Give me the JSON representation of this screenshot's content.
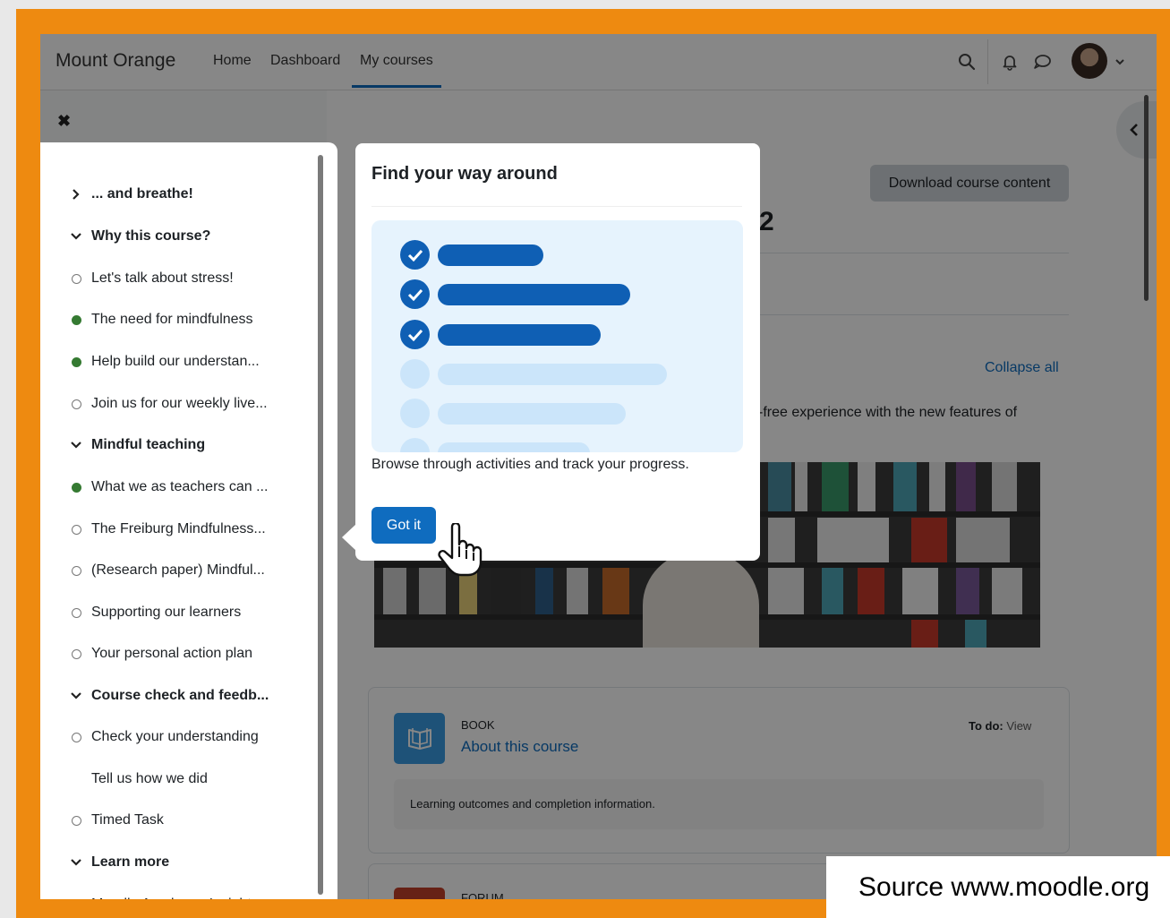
{
  "navbar": {
    "brand": "Mount Orange",
    "links": [
      "Home",
      "Dashboard",
      "My courses"
    ],
    "active_link": "My courses"
  },
  "drawer": {
    "close_symbol": "✖",
    "items": [
      {
        "type": "section",
        "label": "... and breathe!",
        "state": "collapsed"
      },
      {
        "type": "section",
        "label": "Why this course?",
        "state": "expanded"
      },
      {
        "type": "activity",
        "label": "Let's talk about stress!",
        "completion": "incomplete"
      },
      {
        "type": "activity",
        "label": "The need for mindfulness",
        "completion": "complete"
      },
      {
        "type": "activity",
        "label": "Help build our understan...",
        "completion": "complete"
      },
      {
        "type": "activity",
        "label": "Join us for our weekly live...",
        "completion": "incomplete"
      },
      {
        "type": "section",
        "label": "Mindful teaching",
        "state": "expanded"
      },
      {
        "type": "activity",
        "label": "What we as teachers can ...",
        "completion": "complete"
      },
      {
        "type": "activity",
        "label": "The Freiburg Mindfulness...",
        "completion": "incomplete"
      },
      {
        "type": "activity",
        "label": "(Research paper) Mindful...",
        "completion": "incomplete"
      },
      {
        "type": "activity",
        "label": "Supporting our learners",
        "completion": "incomplete"
      },
      {
        "type": "activity",
        "label": "Your personal action plan",
        "completion": "incomplete"
      },
      {
        "type": "section",
        "label": "Course check and feedb...",
        "state": "expanded"
      },
      {
        "type": "activity",
        "label": "Check your understanding",
        "completion": "incomplete"
      },
      {
        "type": "activity",
        "label": "Tell us how we did",
        "completion": "none"
      },
      {
        "type": "activity",
        "label": "Timed Task",
        "completion": "incomplete"
      },
      {
        "type": "section",
        "label": "Learn more",
        "state": "expanded"
      },
      {
        "type": "activity",
        "label": "Moodle Academy: Insight...",
        "completion": "none"
      }
    ]
  },
  "main": {
    "download_label": "Download course content",
    "title_fragment": "2",
    "collapse_all_label": "Collapse all",
    "description_fragment": "-free experience with the new features of",
    "card": {
      "type_label": "BOOK",
      "title": "About this course",
      "todo_label": "To do:",
      "todo_value": "View",
      "description": "Learning outcomes and completion information."
    },
    "card2_type_label": "FORUM"
  },
  "popover": {
    "title": "Find your way around",
    "text": "Browse through activities and track your progress.",
    "button_label": "Got it"
  },
  "source_caption": "Source www.moodle.org",
  "colors": {
    "frame": "#ee8a10",
    "primary": "#0f6cbf",
    "complete": "#357a32",
    "illustration_bg": "#e6f3fd"
  }
}
